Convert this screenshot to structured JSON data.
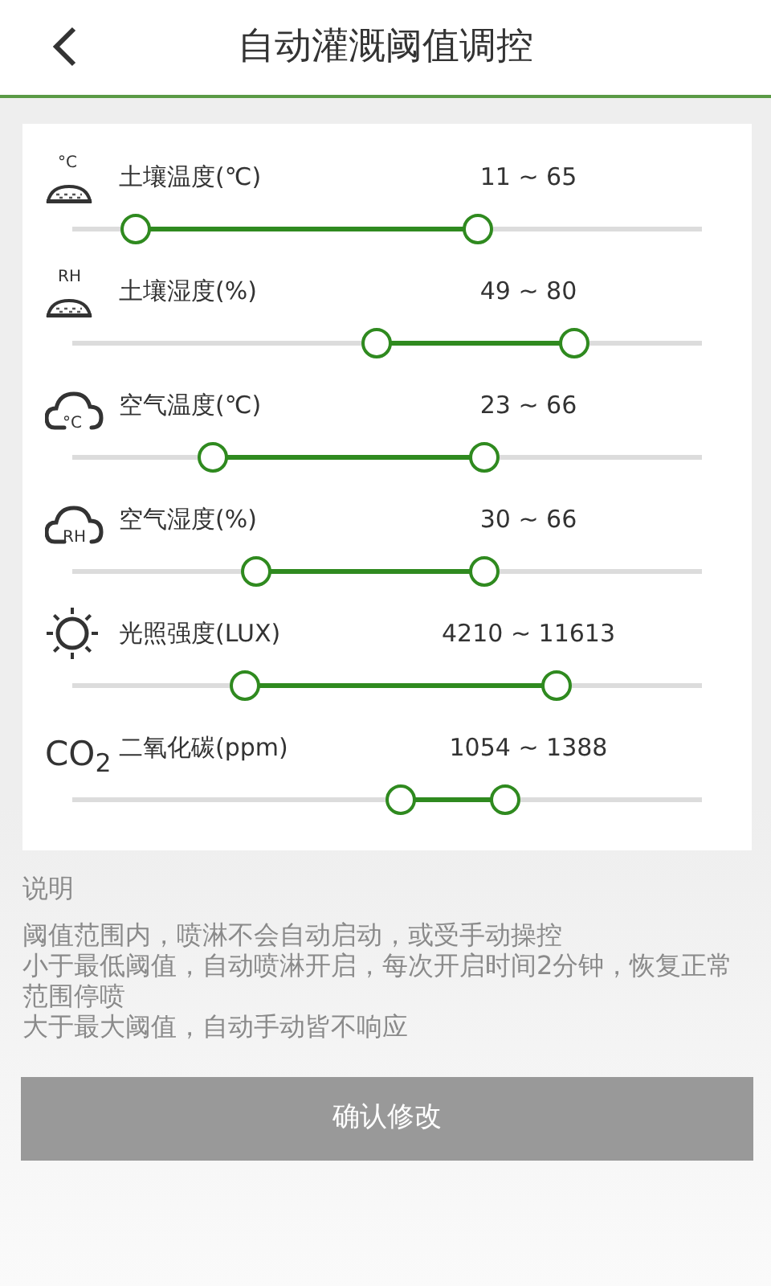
{
  "header": {
    "title": "自动灌溉阈值调控"
  },
  "sensors": [
    {
      "kind": "soil",
      "icon_label": "°C",
      "label": "土壤温度(℃)",
      "range": "11 ~ 65",
      "thumbs": [
        {
          "level": 0.1
        },
        {
          "level": 0.644
        }
      ]
    },
    {
      "kind": "soil",
      "icon_label": "RH",
      "label": "土壤湿度(%)",
      "range": "49 ~ 80",
      "thumbs": [
        {
          "level": 0.483
        },
        {
          "level": 0.796
        }
      ]
    },
    {
      "kind": "cloud",
      "icon_label": "°C",
      "label": "空气温度(℃)",
      "range": "23 ~ 66",
      "thumbs": [
        {
          "level": 0.224
        },
        {
          "level": 0.654
        }
      ]
    },
    {
      "kind": "cloud",
      "icon_label": "RH",
      "label": "空气湿度(%)",
      "range": "30 ~ 66",
      "thumbs": [
        {
          "level": 0.293
        },
        {
          "level": 0.654
        }
      ]
    },
    {
      "kind": "sun",
      "label": "光照强度(LUX)",
      "range": "4210 ~ 11613",
      "thumbs": [
        {
          "level": 0.275
        },
        {
          "level": 0.768
        }
      ]
    },
    {
      "kind": "text",
      "icon_label": "CO$_{2}$",
      "label": "二氧化碳(ppm)",
      "range": "1054 ~ 1388",
      "thumbs": [
        {
          "level": 0.522
        },
        {
          "level": 0.687
        }
      ]
    }
  ],
  "notes": {
    "heading": "说明",
    "lines": [
      "阈值范围内，喷淋不会自动启动，或受手动操控",
      "小于最低阈值，自动喷淋开启，每次开启时间2分钟，恢复正常范围停喷",
      "大于最大阈值，自动手动皆不响应"
    ]
  },
  "confirm_button": "确认修改"
}
